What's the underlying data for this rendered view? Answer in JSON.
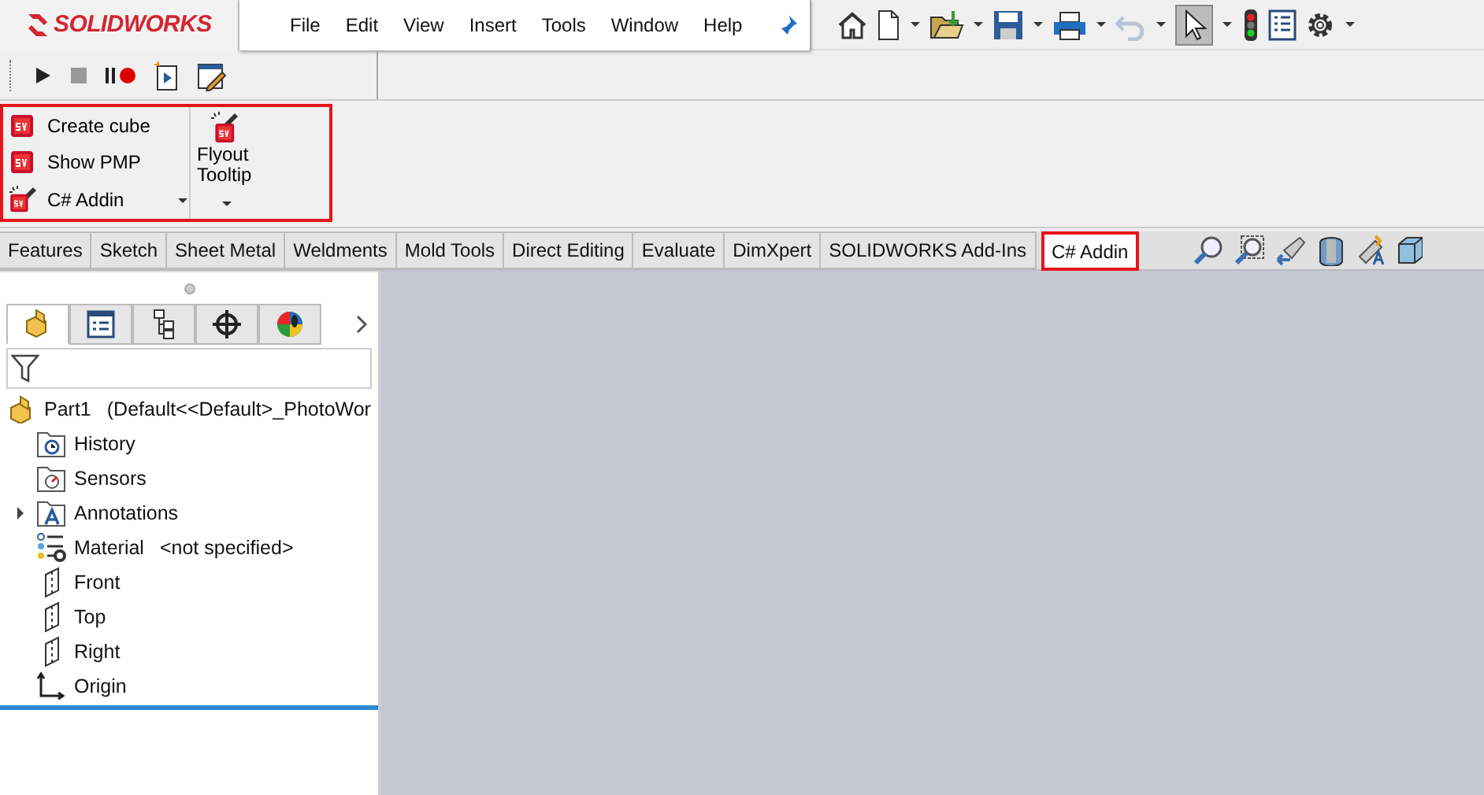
{
  "app": {
    "logo": "SOLIDWORKS"
  },
  "menu": [
    "File",
    "Edit",
    "View",
    "Insert",
    "Tools",
    "Window",
    "Help"
  ],
  "command_manager": {
    "highlighted": true,
    "buttons": [
      {
        "label": "Create cube",
        "kind": "small",
        "dropdown": false
      },
      {
        "label": "Show PMP",
        "kind": "small",
        "dropdown": false
      },
      {
        "label": "C# Addin",
        "kind": "small",
        "dropdown": true
      },
      {
        "label": "Flyout Tooltip",
        "kind": "large",
        "dropdown": true
      }
    ]
  },
  "tabs": [
    {
      "label": "Features",
      "selected": false,
      "highlighted": false
    },
    {
      "label": "Sketch",
      "selected": false,
      "highlighted": false
    },
    {
      "label": "Sheet Metal",
      "selected": false,
      "highlighted": false
    },
    {
      "label": "Weldments",
      "selected": false,
      "highlighted": false
    },
    {
      "label": "Mold Tools",
      "selected": false,
      "highlighted": false
    },
    {
      "label": "Direct Editing",
      "selected": false,
      "highlighted": false
    },
    {
      "label": "Evaluate",
      "selected": false,
      "highlighted": false
    },
    {
      "label": "DimXpert",
      "selected": false,
      "highlighted": false
    },
    {
      "label": "SOLIDWORKS Add-Ins",
      "selected": false,
      "highlighted": false
    },
    {
      "label": "C# Addin",
      "selected": true,
      "highlighted": true
    }
  ],
  "panel_tabs": [
    {
      "kind": "part",
      "selected": true
    },
    {
      "kind": "properties",
      "selected": false
    },
    {
      "kind": "config",
      "selected": false
    },
    {
      "kind": "dimxpert",
      "selected": false
    },
    {
      "kind": "display",
      "selected": false
    }
  ],
  "tree": {
    "label": "Part1",
    "config": "(Default<<Default>_PhotoWor",
    "children": [
      {
        "label": "History",
        "kind": "history"
      },
      {
        "label": "Sensors",
        "kind": "sensors"
      },
      {
        "label": "Annotations",
        "kind": "annotations",
        "expanded": false
      },
      {
        "label": "Material",
        "note": "<not specified>",
        "kind": "material"
      },
      {
        "label": "Front",
        "kind": "plane"
      },
      {
        "label": "Top",
        "kind": "plane"
      },
      {
        "label": "Right",
        "kind": "plane"
      },
      {
        "label": "Origin",
        "kind": "origin"
      }
    ]
  }
}
